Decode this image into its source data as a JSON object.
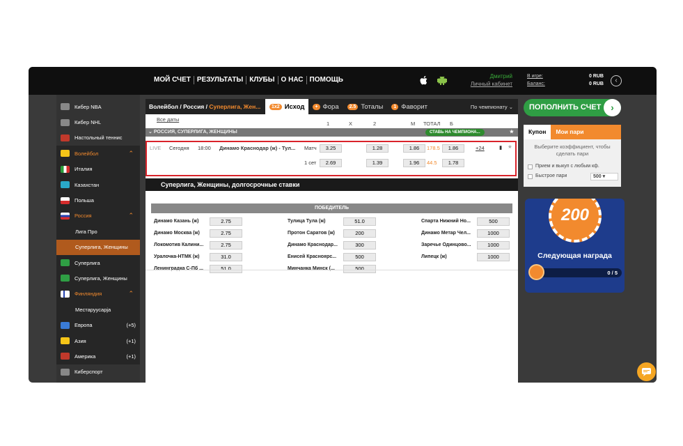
{
  "nav": [
    "МОЙ СЧЕТ",
    "РЕЗУЛЬТАТЫ",
    "КЛУБЫ",
    "О НАС",
    "ПОМОЩЬ"
  ],
  "user": {
    "name": "Дмитрий",
    "cabinet": "Личный кабинет",
    "in_game": "В игре:",
    "balance": "Баланс:",
    "in_game_val": "0 RUB",
    "balance_val": "0 RUB"
  },
  "sidebar": [
    {
      "label": "Кибер NBA",
      "icon": "basketball-icon"
    },
    {
      "label": "Кибер NHL",
      "icon": "hockey-icon"
    },
    {
      "label": "Настольный теннис",
      "icon": "table-tennis-icon"
    },
    {
      "label": "Волейбол",
      "icon": "volleyball-icon",
      "expanded": true
    },
    {
      "label": "Италия",
      "icon": "flag-italy-icon",
      "sub": true
    },
    {
      "label": "Казахстан",
      "icon": "flag-kazakhstan-icon",
      "sub": true
    },
    {
      "label": "Польша",
      "icon": "flag-poland-icon",
      "sub": true
    },
    {
      "label": "Россия",
      "icon": "flag-russia-icon",
      "sub": true,
      "expanded": true
    },
    {
      "label": "Лига Про",
      "sub2": true
    },
    {
      "label": "Суперлига, Женщины",
      "sub2": true,
      "active": true
    },
    {
      "label": "Суперлига",
      "icon": "trophy-icon",
      "sub": true
    },
    {
      "label": "Суперлига, Женщины",
      "icon": "trophy-icon",
      "sub": true
    },
    {
      "label": "Финляндия",
      "icon": "flag-finland-icon",
      "sub": true,
      "expanded": true
    },
    {
      "label": "Местаруусарja",
      "sub2": true
    },
    {
      "label": "Европа",
      "icon": "europe-icon",
      "sub": true,
      "count": "(+5)"
    },
    {
      "label": "Азия",
      "icon": "asia-icon",
      "sub": true,
      "count": "(+1)"
    },
    {
      "label": "Америка",
      "icon": "america-icon",
      "sub": true,
      "count": "(+1)"
    },
    {
      "label": "Киберспорт",
      "icon": "esports-icon"
    }
  ],
  "breadcrumb": {
    "main": "Волейбол / Россия / ",
    "accent": "Суперлига, Жен..."
  },
  "tabs": [
    {
      "badge": "1x2",
      "label": "Исход"
    },
    {
      "badge": "+",
      "label": "Фора"
    },
    {
      "badge": "2.5",
      "label": "Тоталы"
    },
    {
      "badge": "1",
      "label": "Фаворит"
    }
  ],
  "sort": "По чемпионату ⌄",
  "all_dates": "Все даты",
  "cols": {
    "c1": "1",
    "cx": "X",
    "c2": "2",
    "m": "М",
    "total": "ТОТАЛ",
    "b": "Б"
  },
  "league": "РОССИЯ, СУПЕРЛИГА, ЖЕНЩИНЫ",
  "bet_champ": "СТАВЬ НА ЧЕМПИОНА...",
  "event": {
    "live": "LIVE",
    "day": "Сегодня",
    "time": "18:00",
    "teams": "Динамо Краснодар (ж) - Тул...",
    "rows": [
      {
        "type": "Матч",
        "p1": "3.25",
        "p2": "1.28",
        "m": "1.86",
        "total": "178.5",
        "b": "1.86"
      },
      {
        "type": "1 сет",
        "p1": "2.69",
        "p2": "1.39",
        "m": "1.96",
        "total": "44.5",
        "b": "1.78"
      }
    ],
    "more": "+24"
  },
  "longterm": "Суперлига, Женщины, долгосрочные ставки",
  "winner": "ПОБЕДИТЕЛЬ",
  "winners": [
    [
      {
        "t": "Динамо Казань (ж)",
        "o": "2.75"
      },
      {
        "t": "Тулица Тула (ж)",
        "o": "51.0"
      },
      {
        "t": "Спарта Нижний Но...",
        "o": "500"
      }
    ],
    [
      {
        "t": "Динамо Москва (ж)",
        "o": "2.75"
      },
      {
        "t": "Протон Саратов (ж)",
        "o": "200"
      },
      {
        "t": "Динамо Метар Чел...",
        "o": "1000"
      }
    ],
    [
      {
        "t": "Локомотив Калини...",
        "o": "2.75"
      },
      {
        "t": "Динамо Краснодар...",
        "o": "300"
      },
      {
        "t": "Заречье Одинцово...",
        "o": "1000"
      }
    ],
    [
      {
        "t": "Уралочка-НТМК (ж)",
        "o": "31.0"
      },
      {
        "t": "Енисей Красноярс...",
        "o": "500"
      },
      {
        "t": "Липецк (ж)",
        "o": "1000"
      }
    ],
    [
      {
        "t": "Ленинградка С-Пб ...",
        "o": "51.0"
      },
      {
        "t": "Минчанка Минск (...",
        "o": "500"
      }
    ]
  ],
  "deposit": "ПОПОЛНИТЬ СЧЕТ",
  "coupon": {
    "tab1": "Купон",
    "tab2": "Мои пари",
    "text": "Выберите коэффициент, чтобы сделать пари",
    "opt1": "Прием и выкуп с любым кф.",
    "opt2": "Быстрое пари",
    "amount": "500"
  },
  "promo": {
    "chip": "200",
    "title": "Следующая награда",
    "progress": "0 / 5"
  },
  "colors": {
    "accent": "#f28a2e",
    "green": "#2f9e44",
    "red": "#d9232a"
  }
}
